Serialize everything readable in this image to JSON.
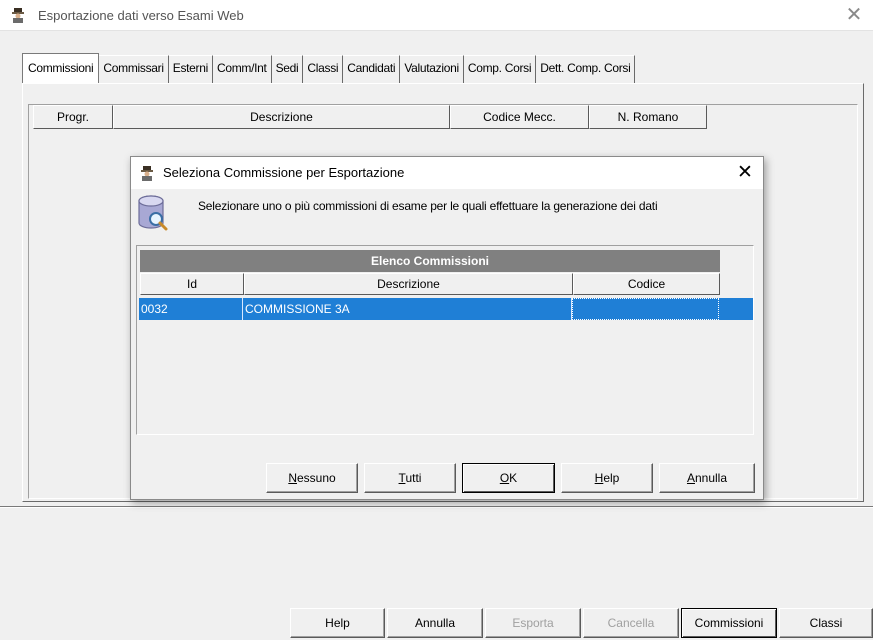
{
  "window": {
    "title": "Esportazione dati verso Esami Web",
    "close_glyph": "✕"
  },
  "tabs": [
    {
      "label": "Commissioni",
      "active": true
    },
    {
      "label": "Commissari"
    },
    {
      "label": "Esterni"
    },
    {
      "label": "Comm/Int"
    },
    {
      "label": "Sedi"
    },
    {
      "label": "Classi"
    },
    {
      "label": "Candidati"
    },
    {
      "label": "Valutazioni"
    },
    {
      "label": "Comp. Corsi"
    },
    {
      "label": "Dett. Comp. Corsi"
    }
  ],
  "main_table": {
    "columns": [
      "Progr.",
      "Descrizione",
      "Codice Mecc.",
      "N. Romano"
    ]
  },
  "bottom_buttons": {
    "help": "Help",
    "annulla": "Annulla",
    "esporta": "Esporta",
    "cancella": "Cancella",
    "commissioni": "Commissioni",
    "classi": "Classi"
  },
  "dialog": {
    "title": "Seleziona Commissione per Esportazione",
    "close_glyph": "✕",
    "message": "Selezionare uno o più commissioni di esame per le quali effettuare la generazione dei dati",
    "grid": {
      "caption": "Elenco Commissioni",
      "columns": [
        "Id",
        "Descrizione",
        "Codice"
      ],
      "rows": [
        {
          "id": "0032",
          "descrizione": "COMMISSIONE 3A",
          "codice": ""
        }
      ]
    },
    "buttons": {
      "nessuno": {
        "pre": "",
        "ul": "N",
        "post": "essuno"
      },
      "tutti": {
        "pre": "",
        "ul": "T",
        "post": "utti"
      },
      "ok": {
        "pre": "",
        "ul": "O",
        "post": "K"
      },
      "help": {
        "pre": "",
        "ul": "H",
        "post": "elp"
      },
      "annulla": {
        "pre": "",
        "ul": "A",
        "post": "nnulla"
      }
    }
  },
  "colors": {
    "selection": "#1f7fd6",
    "grid_caption": "#808080"
  }
}
